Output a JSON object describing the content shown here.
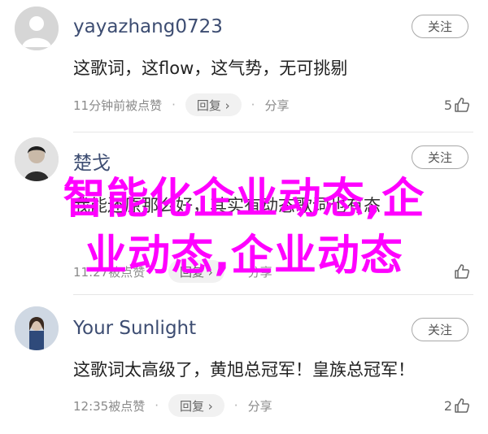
{
  "comments": [
    {
      "username": "yayazhang0723",
      "follow_label": "关注",
      "content": "这歌词，这flow，这气势，无可挑剔",
      "time": "11分钟前被点赞",
      "reply_label": "回复 ›",
      "share_label": "分享",
      "like_count": "5"
    },
    {
      "username": "楚戈",
      "follow_label": "关注",
      "content": "我能还原那么好，其实有动态歌词也有态",
      "time": "11:27被点赞",
      "reply_label": "回复 ›",
      "share_label": "分享",
      "like_count": ""
    },
    {
      "username": "Your Sunlight",
      "follow_label": "关注",
      "content": "这歌词太高级了，黄旭总冠军！皇族总冠军！",
      "time": "12:35被点赞",
      "reply_label": "回复 ›",
      "share_label": "分享",
      "like_count": "2"
    }
  ],
  "overlay": {
    "line1": "智能化企业动态,企",
    "line2": "业动态,企业动态"
  },
  "colors": {
    "username": "#3d4d72",
    "overlay": "#ff00ff",
    "meta": "#8a8a8a"
  }
}
